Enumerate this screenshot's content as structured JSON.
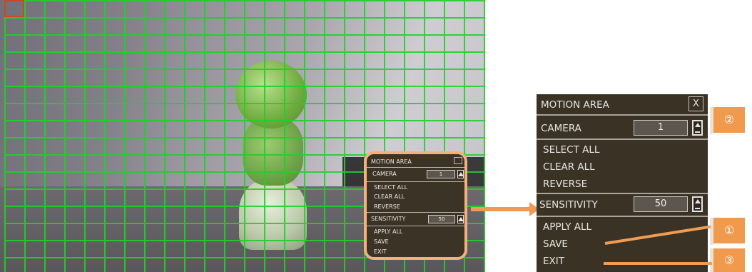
{
  "small_menu": {
    "title": "MOTION AREA",
    "camera_label": "CAMERA",
    "camera_value": "1",
    "select_all": "SELECT ALL",
    "clear_all": "CLEAR ALL",
    "reverse": "REVERSE",
    "sensitivity_label": "SENSITIVITY",
    "sensitivity_value": "50",
    "apply_all": "APPLY ALL",
    "save": "SAVE",
    "exit": "EXIT"
  },
  "big_menu": {
    "title": "MOTION AREA",
    "close": "X",
    "camera_label": "CAMERA",
    "camera_value": "1",
    "select_all": "SELECT ALL",
    "clear_all": "CLEAR ALL",
    "reverse": "REVERSE",
    "sensitivity_label": "SENSITIVITY",
    "sensitivity_value": "50",
    "apply_all": "APPLY ALL",
    "save": "SAVE",
    "exit": "EXIT"
  },
  "callouts": {
    "one": "①",
    "two": "②",
    "three": "③"
  },
  "colors": {
    "grid": "#1fd12a",
    "menu_bg": "#3a3225",
    "accent": "#f09a4e"
  }
}
